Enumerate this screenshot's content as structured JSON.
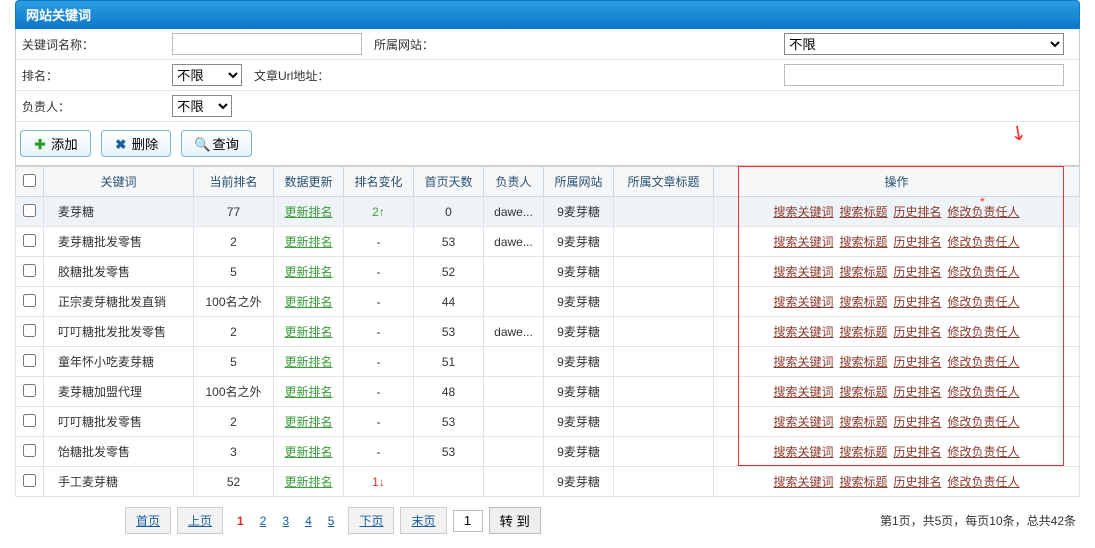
{
  "header": {
    "title": "网站关键词"
  },
  "form": {
    "name_label": "关键词名称：",
    "site_label": "所属网站：",
    "site_value": "不限",
    "rank_label": "排名：",
    "rank_value": "不限",
    "url_label": "文章Url地址：",
    "owner_label": "负责人：",
    "owner_value": "不限"
  },
  "toolbar": {
    "add": "添加",
    "del": "删除",
    "query": "查询"
  },
  "columns": {
    "kw": "关键词",
    "rank": "当前排名",
    "update": "数据更新",
    "change": "排名变化",
    "days": "首页天数",
    "owner": "负责人",
    "site": "所属网站",
    "article": "所属文章标题",
    "ops": "操作"
  },
  "update_label": "更新排名",
  "op_labels": {
    "search_kw": "搜索关键词",
    "search_title": "搜索标题",
    "history": "历史排名",
    "modify_owner": "修改负责任人"
  },
  "rows": [
    {
      "kw": "麦芽糖",
      "rank": "77",
      "change": "2",
      "change_dir": "up",
      "days": "0",
      "owner": "dawe...",
      "site": "9麦芽糖",
      "article": "",
      "selected": true
    },
    {
      "kw": "麦芽糖批发零售",
      "rank": "2",
      "change": "-",
      "change_dir": "",
      "days": "53",
      "owner": "dawe...",
      "site": "9麦芽糖",
      "article": ""
    },
    {
      "kw": "胶糖批发零售",
      "rank": "5",
      "change": "-",
      "change_dir": "",
      "days": "52",
      "owner": "",
      "site": "9麦芽糖",
      "article": ""
    },
    {
      "kw": "正宗麦芽糖批发直销",
      "rank": "100名之外",
      "change": "-",
      "change_dir": "",
      "days": "44",
      "owner": "",
      "site": "9麦芽糖",
      "article": ""
    },
    {
      "kw": "叮叮糖批发批发零售",
      "rank": "2",
      "change": "-",
      "change_dir": "",
      "days": "53",
      "owner": "dawe...",
      "site": "9麦芽糖",
      "article": ""
    },
    {
      "kw": "童年怀小吃麦芽糖",
      "rank": "5",
      "change": "-",
      "change_dir": "",
      "days": "51",
      "owner": "",
      "site": "9麦芽糖",
      "article": ""
    },
    {
      "kw": "麦芽糖加盟代理",
      "rank": "100名之外",
      "change": "-",
      "change_dir": "",
      "days": "48",
      "owner": "",
      "site": "9麦芽糖",
      "article": ""
    },
    {
      "kw": "叮叮糖批发零售",
      "rank": "2",
      "change": "-",
      "change_dir": "",
      "days": "53",
      "owner": "",
      "site": "9麦芽糖",
      "article": ""
    },
    {
      "kw": "饴糖批发零售",
      "rank": "3",
      "change": "-",
      "change_dir": "",
      "days": "53",
      "owner": "",
      "site": "9麦芽糖",
      "article": ""
    },
    {
      "kw": "手工麦芽糖",
      "rank": "52",
      "change": "1",
      "change_dir": "down",
      "days": "",
      "owner": "",
      "site": "9麦芽糖",
      "article": ""
    }
  ],
  "pager": {
    "first": "首页",
    "prev": "上页",
    "next": "下页",
    "last": "末页",
    "go": "转 到",
    "pages": [
      "1",
      "2",
      "3",
      "4",
      "5"
    ],
    "current": "1",
    "goto_value": "1",
    "info": "第1页，共5页，每页10条，总共42条"
  }
}
